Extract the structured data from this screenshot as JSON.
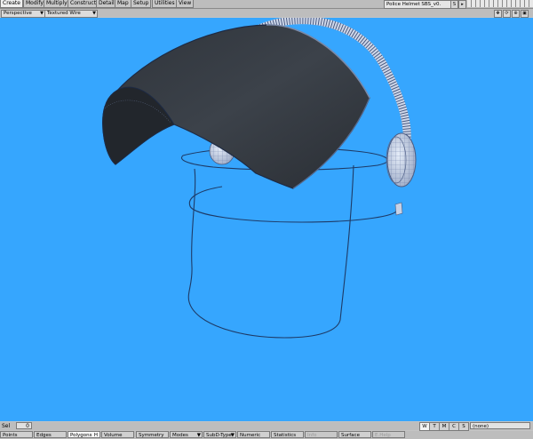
{
  "menu_tabs": [
    "Create",
    "Modify",
    "Multiply",
    "Construct",
    "Detail",
    "Map",
    "Setup",
    "Utilities",
    "View"
  ],
  "active_tab": "Create",
  "file_name": "Police Helmet SBS_v0.",
  "file_buttons": [
    "S",
    "▸"
  ],
  "viewport": {
    "view_type": "Perspective",
    "render_mode": "Textured Wire"
  },
  "selection": {
    "label": "Sel",
    "count": "0",
    "wtmcs": [
      "W",
      "T",
      "M",
      "C",
      "S"
    ],
    "surface_select": "(none)"
  },
  "modes": {
    "points": "Points",
    "edges": "Edges",
    "polygons": "Polygons",
    "polygons_hint": "H",
    "volume": "Volume",
    "symmetry": "Symmetry",
    "modes": "Modes",
    "subd_type": "SubD-Type",
    "numeric": "Numeric",
    "statistics": "Statistics",
    "info": "Info",
    "surface": "Surface",
    "extra": "E.Help"
  },
  "colors": {
    "viewport_bg": "#36a6fe",
    "visor": "#3a3f46",
    "wire": "#1e3a66"
  }
}
